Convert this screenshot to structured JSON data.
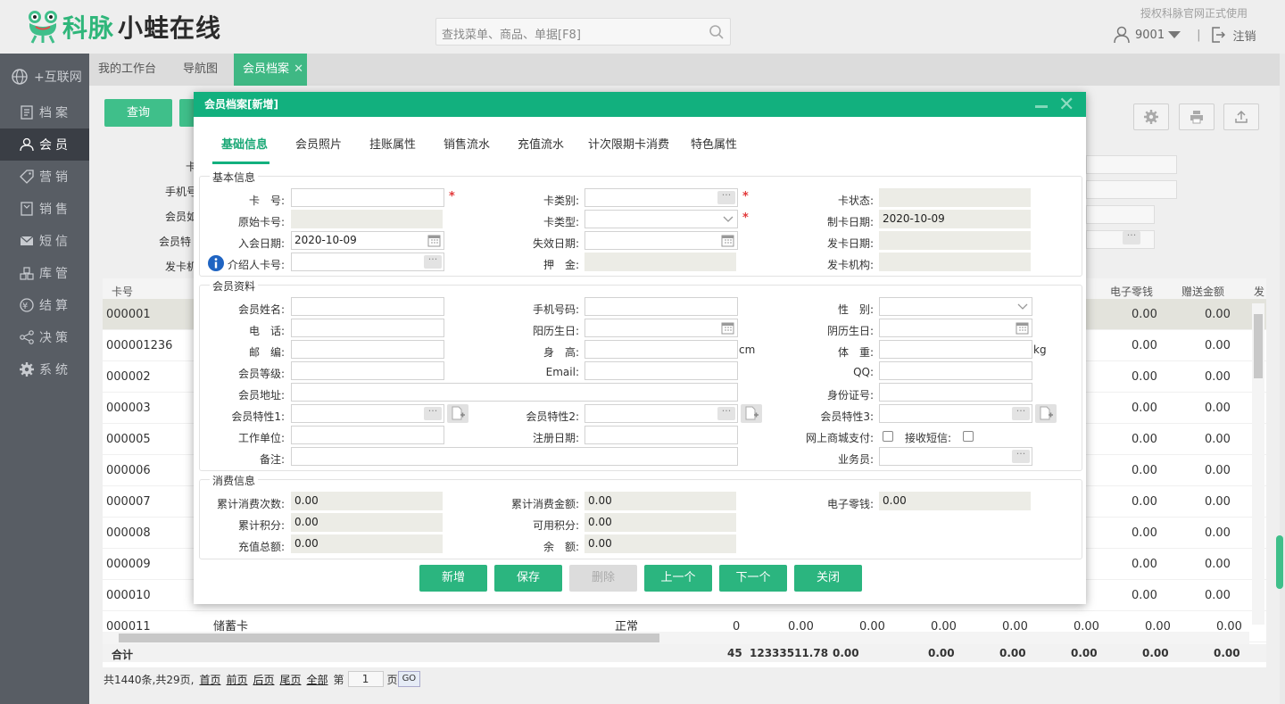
{
  "app": {
    "name_green": "科脉",
    "name_dark": "小蛙在线",
    "auth_text": "授权科脉官网正式使用",
    "user": "9001",
    "logout": "注销"
  },
  "search": {
    "placeholder": "查找菜单、商品、单据[F8]"
  },
  "sidebar": {
    "internet": "+互联网",
    "items": [
      {
        "label": "档案",
        "icon": "file-icon"
      },
      {
        "label": "会员",
        "icon": "person-icon",
        "active": true
      },
      {
        "label": "营销",
        "icon": "tag-icon"
      },
      {
        "label": "销售",
        "icon": "receipt-icon"
      },
      {
        "label": "短信",
        "icon": "mail-icon"
      },
      {
        "label": "库管",
        "icon": "warehouse-icon"
      },
      {
        "label": "结算",
        "icon": "yuan-icon"
      },
      {
        "label": "决策",
        "icon": "share-icon"
      },
      {
        "label": "系统",
        "icon": "gear-icon"
      }
    ]
  },
  "tabs": [
    "我的工作台",
    "导航图",
    "会员档案"
  ],
  "toolbar": {
    "query": "查询"
  },
  "grid": {
    "headers": {
      "card": "卡号",
      "ewallet": "电子零钱",
      "gift": "赠送金额",
      "more": "发"
    },
    "rows": [
      {
        "card": "000001",
        "ewallet": "0.00",
        "gift": "0.00"
      },
      {
        "card": "000001236",
        "ewallet": "0.00",
        "gift": "0.00"
      },
      {
        "card": "000002",
        "ewallet": "0.00",
        "gift": "0.00"
      },
      {
        "card": "000003",
        "ewallet": "0.00",
        "gift": "0.00"
      },
      {
        "card": "000005",
        "ewallet": "0.00",
        "gift": "0.00"
      },
      {
        "card": "000006",
        "ewallet": "0.00",
        "gift": "0.00"
      },
      {
        "card": "000007",
        "ewallet": "0.00",
        "gift": "0.00"
      },
      {
        "card": "000008",
        "ewallet": "0.00",
        "gift": "0.00"
      },
      {
        "card": "000009",
        "ewallet": "0.00",
        "gift": "0.00"
      },
      {
        "card": "000010",
        "ewallet": "0.00",
        "gift": "0.00"
      }
    ],
    "partial_row": {
      "card": "000011",
      "type": "储蓄卡",
      "status": "正常",
      "num": "0",
      "vals": [
        "0.00",
        "0.00",
        "0.00",
        "0.00",
        "0.00",
        "0.00",
        "0.00"
      ]
    },
    "totals": {
      "label": "合计",
      "count": "45",
      "amount": "12333511.78",
      "vals": [
        "0.00",
        "0.00",
        "0.00",
        "0.00",
        "0.00",
        "0.00"
      ]
    }
  },
  "filters": {
    "to1": "至",
    "to2": "至",
    "labels": [
      "卡",
      "手机号",
      "会员如",
      "会员特",
      "发卡机"
    ]
  },
  "pager": {
    "summary": "共1440条,共29页,",
    "first": "首页",
    "prev": "前页",
    "next": "后页",
    "last": "尾页",
    "all": "全部",
    "page_prefix": "第",
    "page": "1",
    "page_suffix": "页",
    "go": "GO"
  },
  "dialog": {
    "title": "会员档案[新增]",
    "tabs": [
      "基础信息",
      "会员照片",
      "挂账属性",
      "销售流水",
      "充值流水",
      "计次限期卡消费",
      "特色属性"
    ],
    "basic": {
      "title": "基本信息",
      "card_no": "卡　号:",
      "card_category": "卡类别:",
      "card_status": "卡状态:",
      "orig_card": "原始卡号:",
      "card_type": "卡类型:",
      "make_date": "制卡日期:",
      "make_date_val": "2020-10-09",
      "join_date": "入会日期:",
      "join_date_val": "2020-10-09",
      "expire_date": "失效日期:",
      "issue_date": "发卡日期:",
      "referrer": "介绍人卡号:",
      "deposit": "押　金:",
      "issue_org": "发卡机构:"
    },
    "profile": {
      "title": "会员资料",
      "name": "会员姓名:",
      "mobile": "手机号码:",
      "gender": "性　别:",
      "phone": "电　话:",
      "solar_bd": "阳历生日:",
      "lunar_bd": "阴历生日:",
      "zip": "邮　编:",
      "height": "身　高:",
      "cm": "cm",
      "weight": "体　重:",
      "kg": "kg",
      "level": "会员等级:",
      "email": "Email:",
      "qq": "QQ:",
      "address": "会员地址:",
      "idcard": "身份证号:",
      "attr1": "会员特性1:",
      "attr2": "会员特性2:",
      "attr3": "会员特性3:",
      "company": "工作单位:",
      "reg_date": "注册日期:",
      "online_pay": "网上商城支付:",
      "recv_sms": "接收短信:",
      "remark": "备注:",
      "salesman": "业务员:"
    },
    "consume": {
      "title": "消费信息",
      "count": "累计消费次数:",
      "count_val": "0.00",
      "amount": "累计消费金额:",
      "amount_val": "0.00",
      "ewallet": "电子零钱:",
      "ewallet_val": "0.00",
      "points": "累计积分:",
      "points_val": "0.00",
      "avail_points": "可用积分:",
      "avail_points_val": "0.00",
      "recharge": "充值总额:",
      "recharge_val": "0.00",
      "balance": "余　额:",
      "balance_val": "0.00"
    },
    "buttons": {
      "add": "新增",
      "save": "保存",
      "delete": "删除",
      "prev": "上一个",
      "next": "下一个",
      "close": "关闭"
    }
  },
  "colors": {
    "brand": "#12b07e",
    "sidebar": "#585d64",
    "required": "#e2393a"
  }
}
